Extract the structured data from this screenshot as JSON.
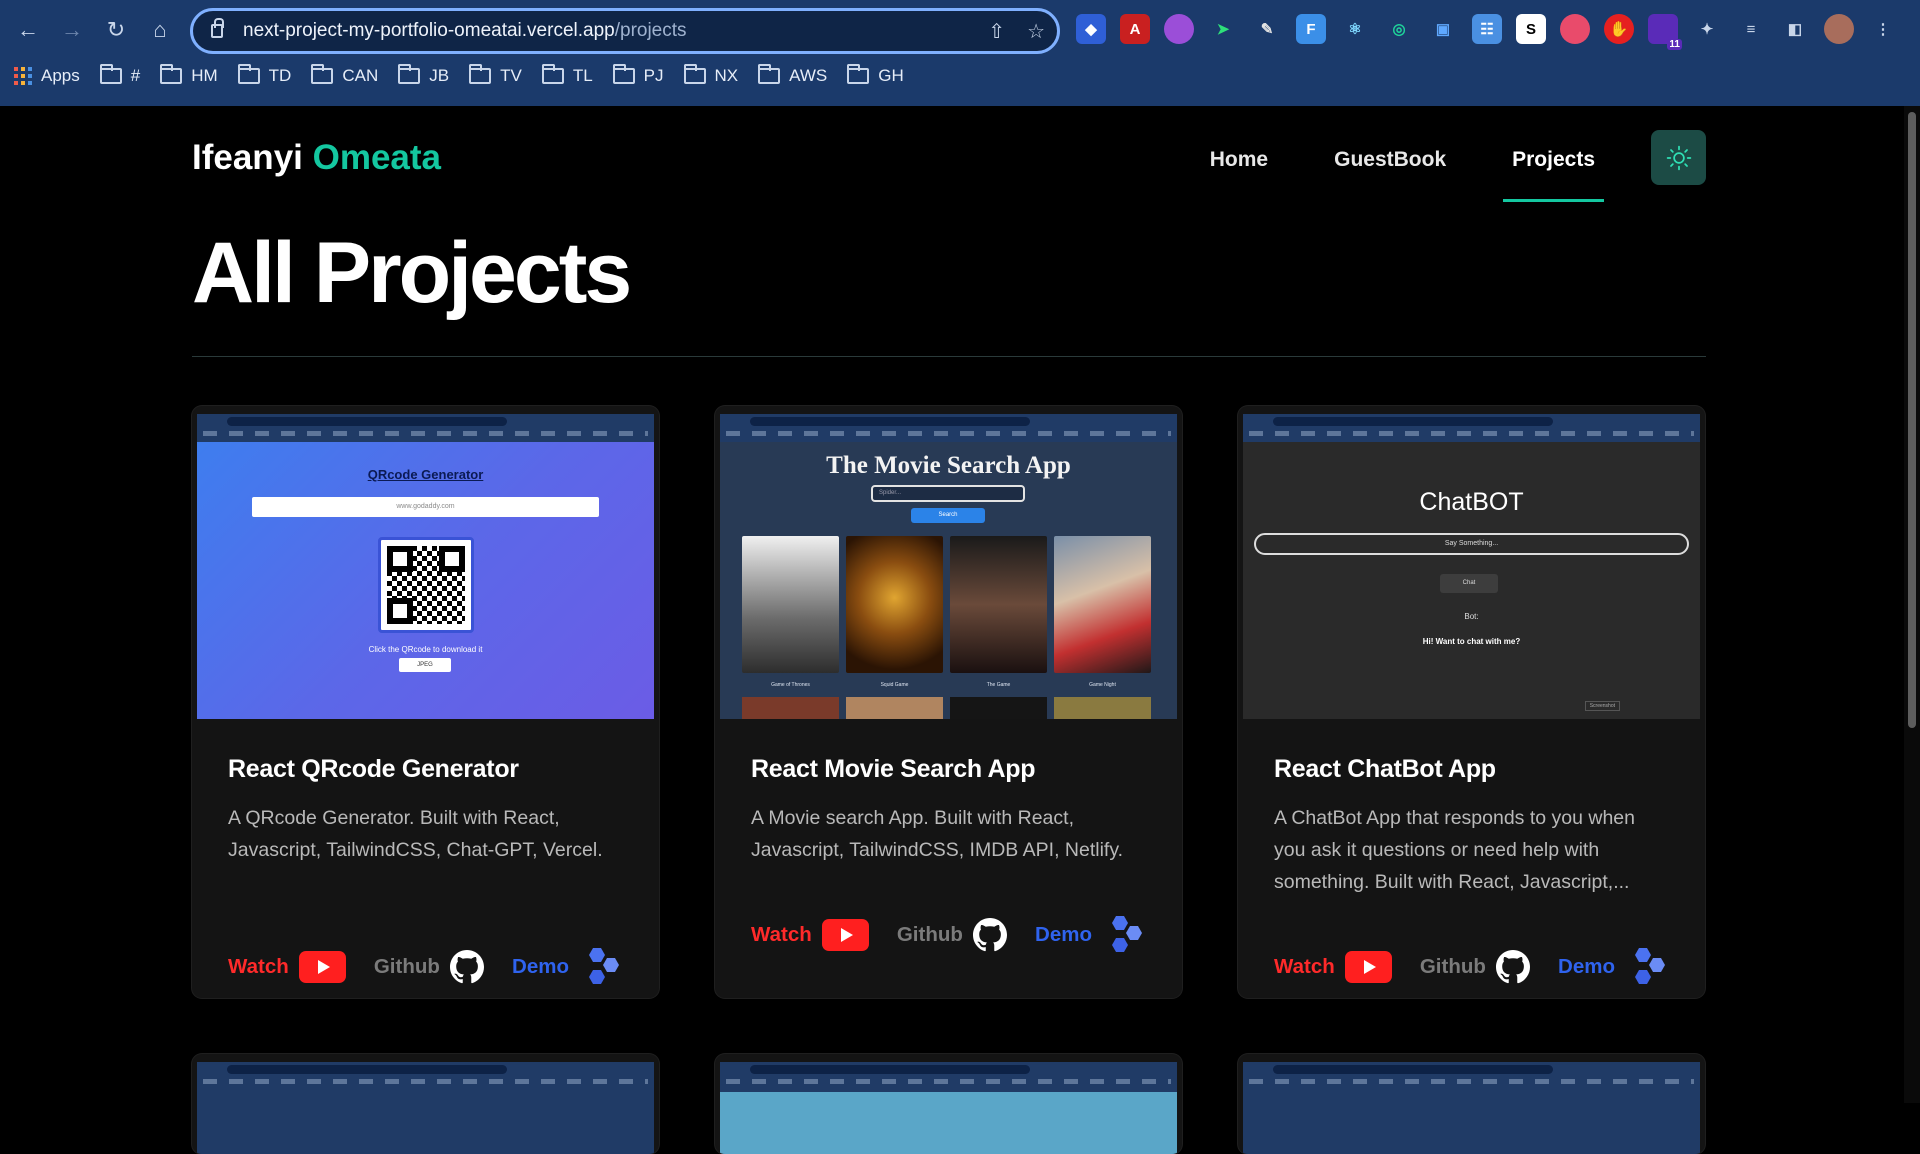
{
  "browser": {
    "url_host": "next-project-my-portfolio-omeatai.vercel.app",
    "url_path": "/projects",
    "bookmarks": [
      {
        "label": "Apps"
      },
      {
        "label": "#"
      },
      {
        "label": "HM"
      },
      {
        "label": "TD"
      },
      {
        "label": "CAN"
      },
      {
        "label": "JB"
      },
      {
        "label": "TV"
      },
      {
        "label": "TL"
      },
      {
        "label": "PJ"
      },
      {
        "label": "NX"
      },
      {
        "label": "AWS"
      },
      {
        "label": "GH"
      }
    ],
    "extension_badge": "11"
  },
  "header": {
    "brand_first": "Ifeanyi",
    "brand_last": "Omeata",
    "nav": [
      {
        "label": "Home"
      },
      {
        "label": "GuestBook"
      },
      {
        "label": "Projects"
      }
    ]
  },
  "page": {
    "title": "All Projects"
  },
  "links": {
    "watch": "Watch",
    "github": "Github",
    "demo": "Demo"
  },
  "projects": [
    {
      "title": "React QRcode Generator",
      "description": "A QRcode Generator. Built with React, Javascript, TailwindCSS, Chat-GPT, Vercel.",
      "thumb": {
        "heading": "QRcode Generator",
        "input_value": "www.godaddy.com",
        "hint": "Click the QRcode to download it",
        "button": "JPEG"
      }
    },
    {
      "title": "React Movie Search App",
      "description": "A Movie search App. Built with React, Javascript, TailwindCSS, IMDB API, Netlify.",
      "thumb": {
        "heading": "The Movie Search App",
        "input_value": "Spider...",
        "button": "Search",
        "posters": [
          "Game of Thrones",
          "Squid Game",
          "The Game",
          "Game Night"
        ]
      }
    },
    {
      "title": "React ChatBot App",
      "description": "A ChatBot App that responds to you when you ask it questions or need help with something. Built with React, Javascript,...",
      "thumb": {
        "heading": "ChatBOT",
        "input_value": "Say Something...",
        "button": "Chat",
        "bot_label": "Bot:",
        "bot_message": "Hi! Want to chat with me?",
        "footer": "Screenshot"
      }
    }
  ],
  "colors": {
    "accent": "#14c7a0",
    "watch": "#ff2a2a",
    "github": "#7b7b7b",
    "demo": "#2f63ee"
  }
}
